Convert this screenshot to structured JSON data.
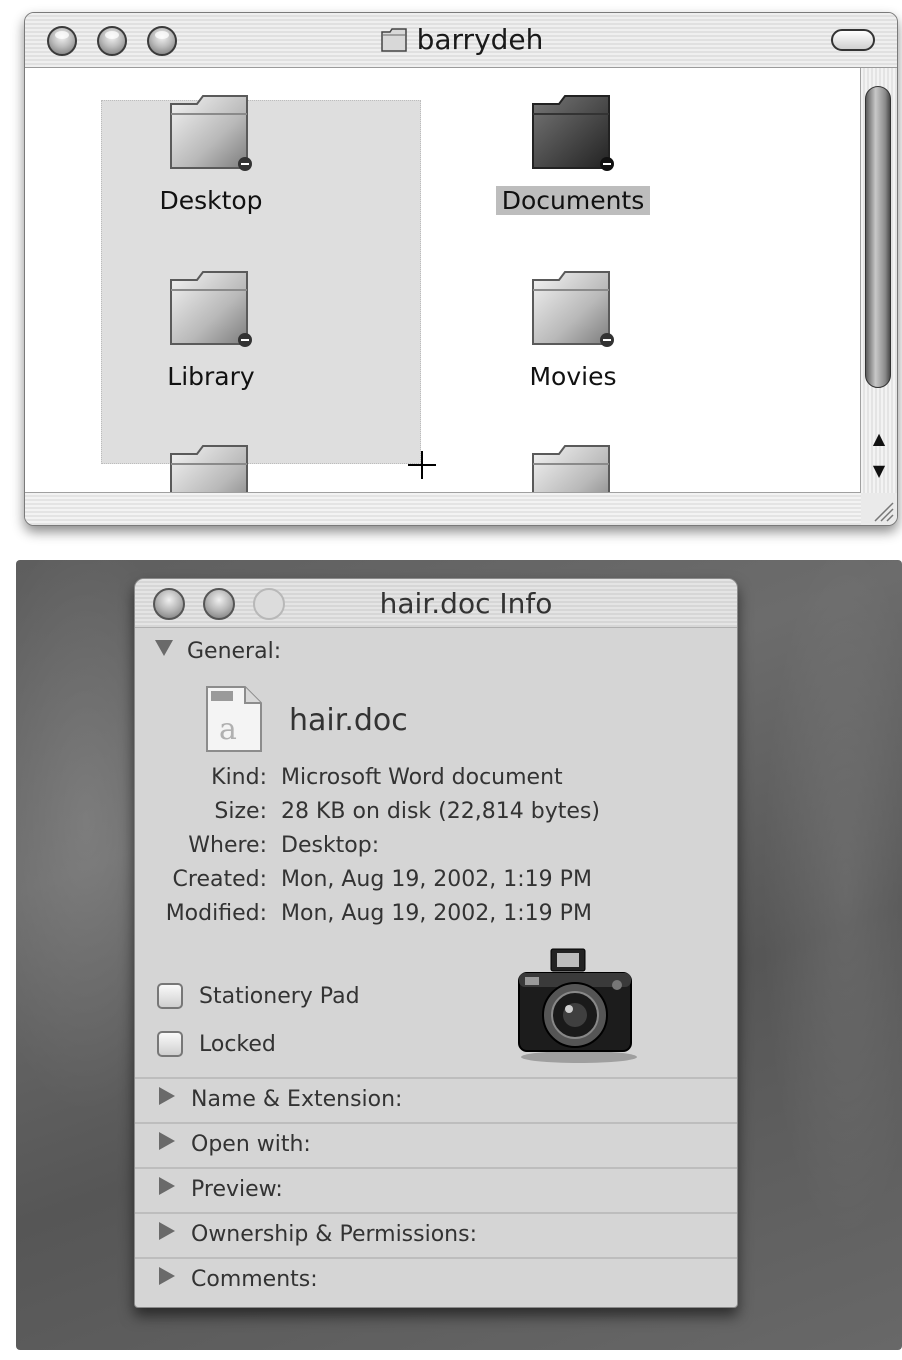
{
  "finder": {
    "title": "barrydeh",
    "items": [
      {
        "label": "Desktop",
        "selected": false,
        "dark": false
      },
      {
        "label": "Documents",
        "selected": true,
        "dark": true
      },
      {
        "label": "Library",
        "selected": false,
        "dark": false
      },
      {
        "label": "Movies",
        "selected": false,
        "dark": false
      }
    ]
  },
  "info": {
    "title": "hair.doc Info",
    "general_label": "General:",
    "file_name": "hair.doc",
    "properties": [
      {
        "key": "Kind:",
        "value": "Microsoft Word document"
      },
      {
        "key": "Size:",
        "value": "28 KB on disk (22,814 bytes)"
      },
      {
        "key": "Where:",
        "value": "Desktop:"
      },
      {
        "key": "Created:",
        "value": "Mon, Aug 19, 2002, 1:19 PM"
      },
      {
        "key": "Modified:",
        "value": "Mon, Aug 19, 2002, 1:19 PM"
      }
    ],
    "checkboxes": [
      {
        "label": "Stationery Pad",
        "checked": false
      },
      {
        "label": "Locked",
        "checked": false
      }
    ],
    "sections": [
      "Name & Extension:",
      "Open with:",
      "Preview:",
      "Ownership & Permissions:",
      "Comments:"
    ]
  },
  "icons": {
    "folder": "folder-icon",
    "document": "word-document-icon",
    "camera": "camera-icon"
  }
}
